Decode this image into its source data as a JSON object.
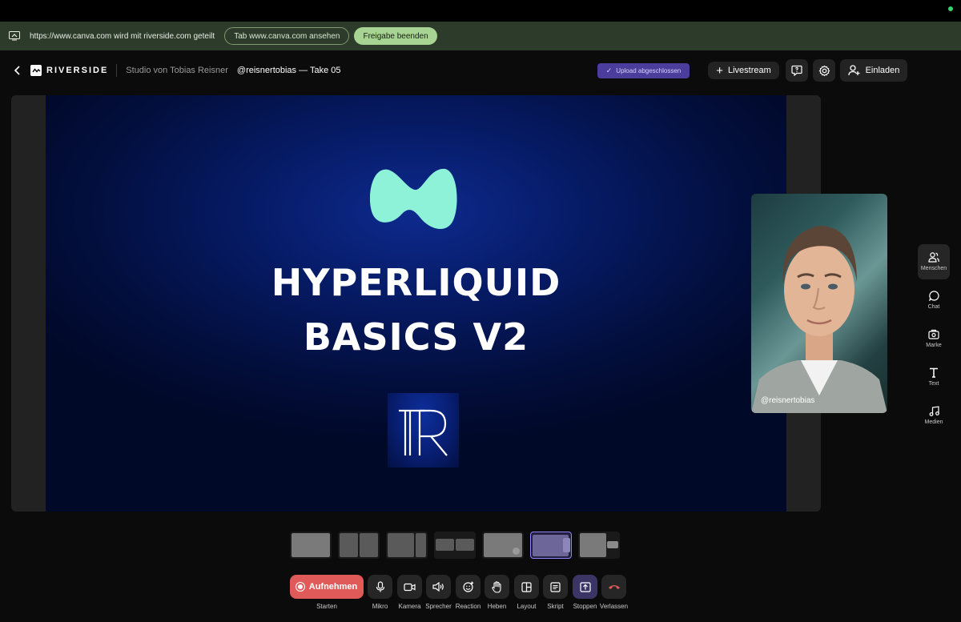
{
  "share_bar": {
    "message": "https://www.canva.com wird mit riverside.com geteilt",
    "view_tab_label": "Tab www.canva.com ansehen",
    "stop_sharing_label": "Freigabe beenden"
  },
  "header": {
    "brand": "RIVERSIDE",
    "studio": "Studio von Tobias Reisner",
    "take": "@reisnertobias — Take 05",
    "upload_status": "Upload abgeschlossen",
    "livestream_label": "Livestream",
    "invite_label": "Einladen"
  },
  "slide": {
    "title_line1": "HYPERLIQUID",
    "title_line2": "BASICS V2",
    "logo_text": "TR"
  },
  "participant": {
    "name": "@reisnertobias"
  },
  "right_nav": [
    {
      "label": "Menschen",
      "icon": "people-icon",
      "active": true
    },
    {
      "label": "Chat",
      "icon": "chat-icon"
    },
    {
      "label": "Marke",
      "icon": "brand-icon"
    },
    {
      "label": "Text",
      "icon": "text-icon"
    },
    {
      "label": "Medien",
      "icon": "music-icon"
    }
  ],
  "layouts": {
    "count": 7,
    "active_index": 5
  },
  "controls": {
    "record_label": "Aufnehmen",
    "record_caption": "Starten",
    "mic": "Mikro",
    "camera": "Kamera",
    "speaker": "Sprecher",
    "reaction": "Reaction",
    "raise": "Heben",
    "layout": "Layout",
    "script": "Skript",
    "stop": "Stoppen",
    "leave": "Verlassen"
  },
  "colors": {
    "share_bar": "#2c3b2a",
    "accent_purple": "#4b3d9c",
    "record_red": "#e05a5a",
    "slide_blue": "#061a63",
    "blob_mint": "#8ef2d8"
  }
}
